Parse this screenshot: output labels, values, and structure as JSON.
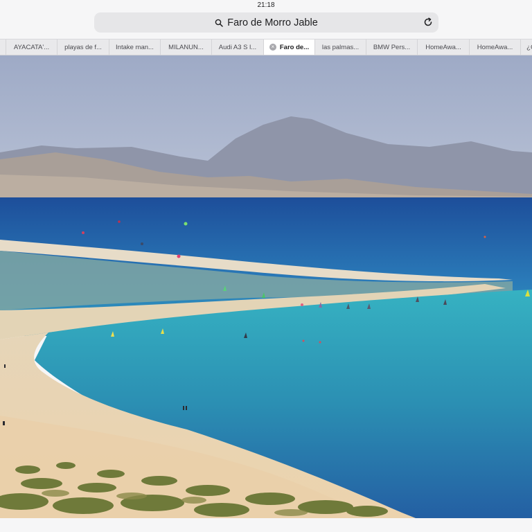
{
  "status_bar": {
    "time": "21:18"
  },
  "address_bar": {
    "text": "Faro de Morro Jable",
    "search_icon": "magnifier-icon",
    "reload_icon": "reload-icon"
  },
  "tabs": [
    {
      "label": "AYACATA'...",
      "active": false
    },
    {
      "label": "playas de f...",
      "active": false
    },
    {
      "label": "Intake man...",
      "active": false
    },
    {
      "label": "MILANUN...",
      "active": false
    },
    {
      "label": "Audi A3 S l...",
      "active": false
    },
    {
      "label": "Faro de...",
      "active": true
    },
    {
      "label": "las palmas...",
      "active": false
    },
    {
      "label": "BMW Pers...",
      "active": false
    },
    {
      "label": "HomeAwa...",
      "active": false
    },
    {
      "label": "HomeAwa...",
      "active": false
    },
    {
      "label": "¿C",
      "active": false
    }
  ],
  "colors": {
    "sky": "#a9b4cc",
    "ocean_deep": "#1f5fa8",
    "lagoon": "#2fa3bb",
    "sand": "#e9d6b5",
    "vegetation": "#6e7a3c"
  }
}
